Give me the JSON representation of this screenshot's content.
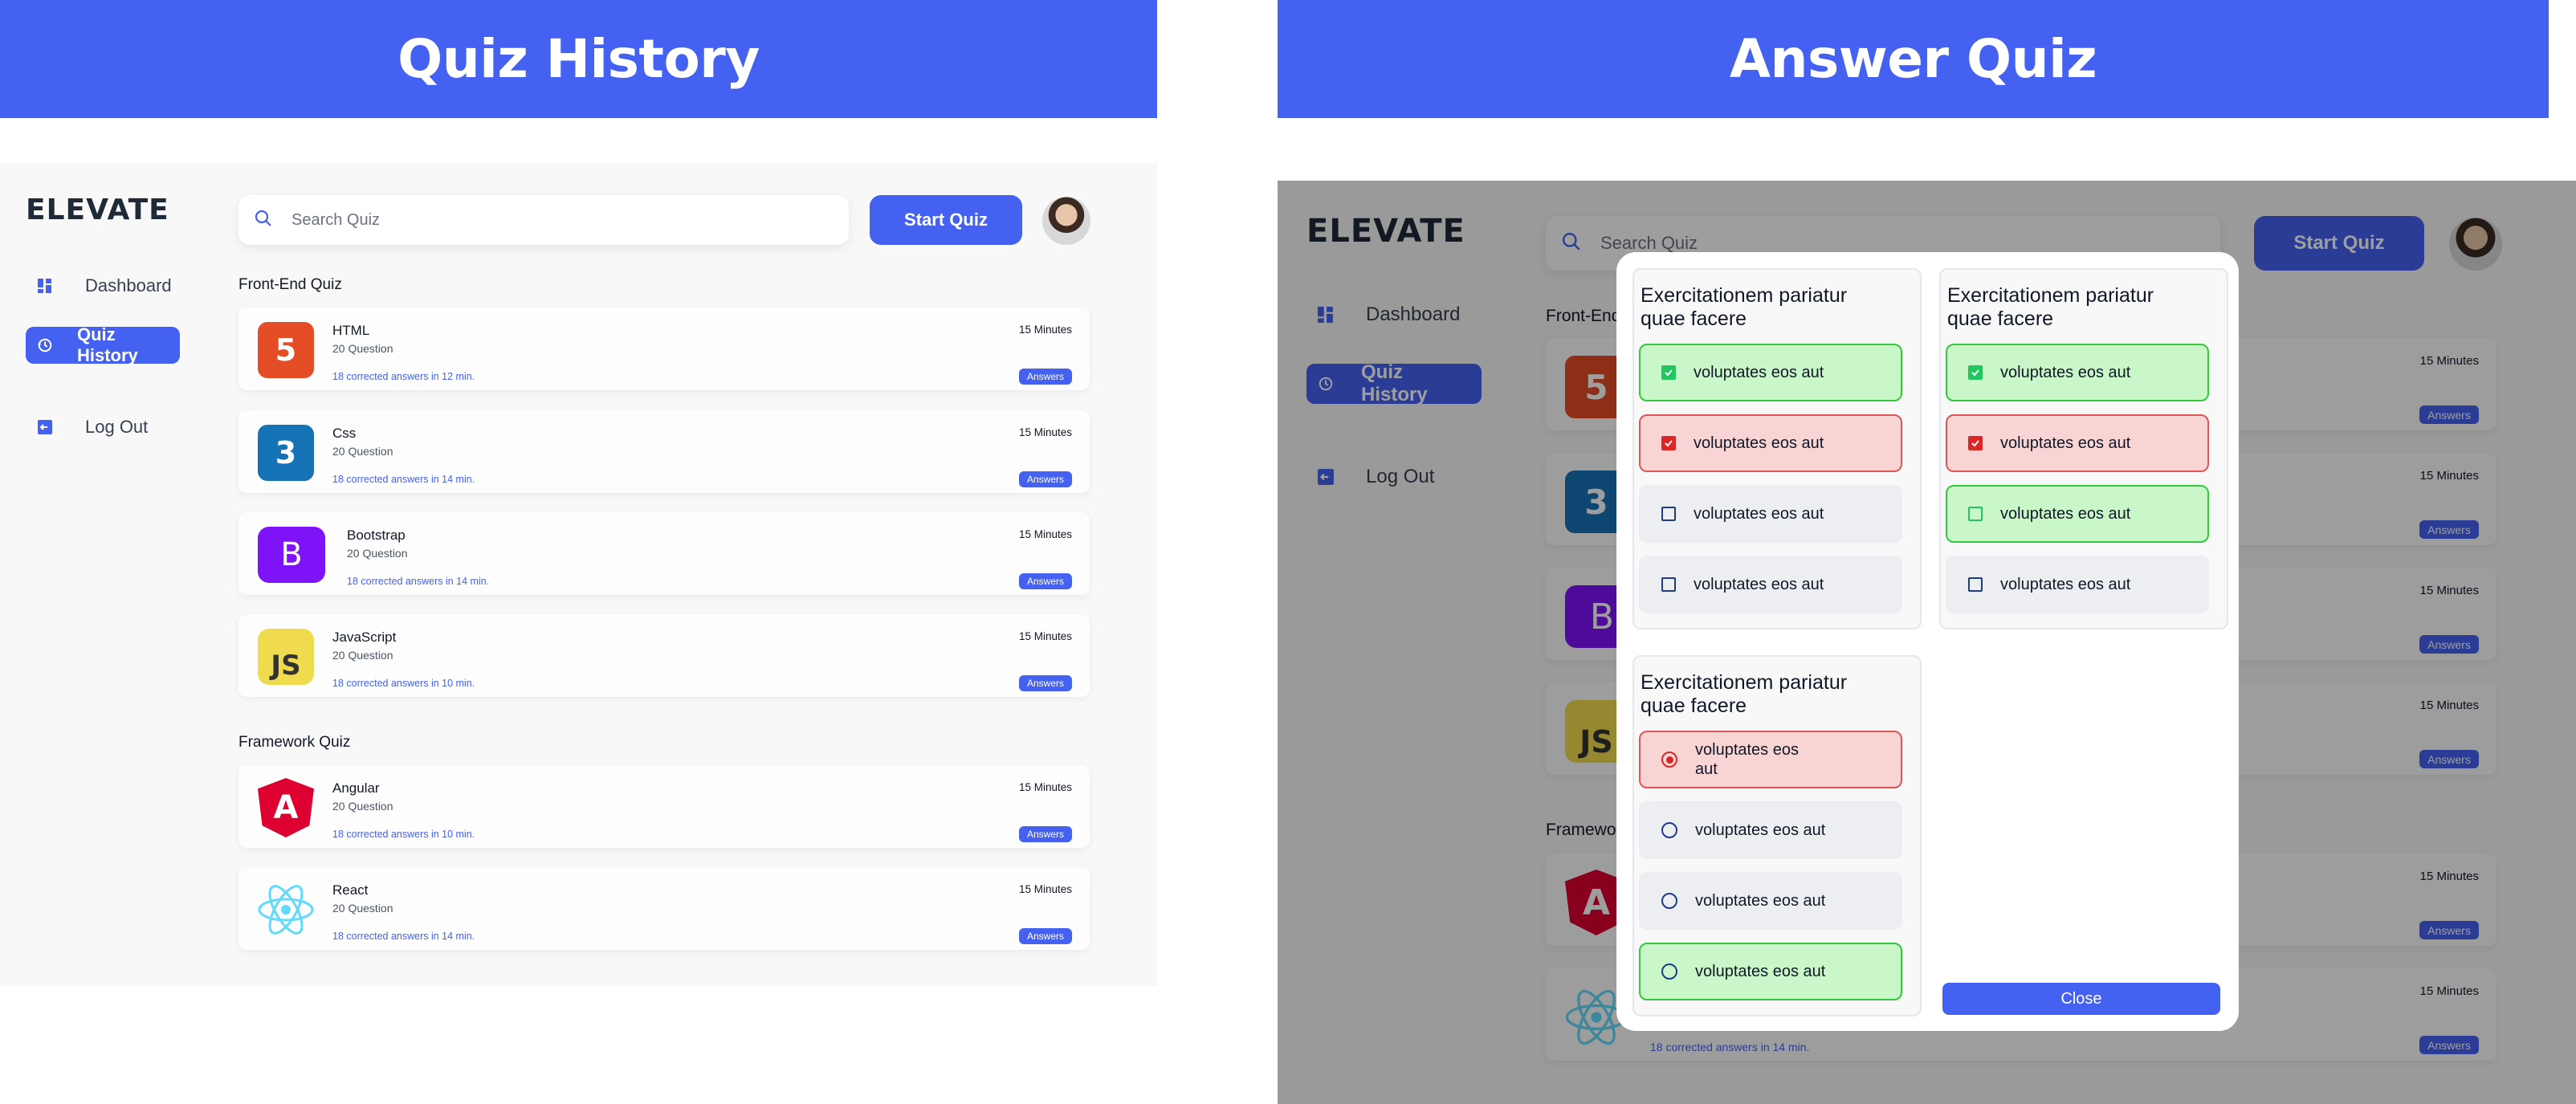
{
  "left": {
    "banner_title": "Quiz History",
    "logo": "ELEVATE",
    "nav": [
      {
        "label": "Dashboard",
        "icon": "dashboard-icon"
      },
      {
        "label": "Quiz History",
        "icon": "history-icon",
        "active": true
      },
      {
        "label": "Log Out",
        "icon": "logout-icon"
      }
    ],
    "search_placeholder": "Search Quiz",
    "start_button": "Start Quiz",
    "sections": [
      {
        "title": "Front-End Quiz",
        "items": [
          {
            "name": "HTML",
            "questions": "20 Question",
            "duration": "15 Minutes",
            "result": "18 corrected answers in 12 min.",
            "answers_label": "Answers",
            "icon": "html5-icon",
            "icon_text": "5",
            "color": "#e44d26"
          },
          {
            "name": "Css",
            "questions": "20 Question",
            "duration": "15 Minutes",
            "result": "18 corrected answers in 14 min.",
            "answers_label": "Answers",
            "icon": "css3-icon",
            "icon_text": "3",
            "color": "#1572b6"
          },
          {
            "name": "Bootstrap",
            "questions": "20 Question",
            "duration": "15 Minutes",
            "result": "18 corrected answers in 14 min.",
            "answers_label": "Answers",
            "icon": "bootstrap-icon",
            "icon_text": "B",
            "color": "#7e13f8"
          },
          {
            "name": "JavaScript",
            "questions": "20 Question",
            "duration": "15 Minutes",
            "result": "18 corrected answers in 10 min.",
            "answers_label": "Answers",
            "icon": "javascript-icon",
            "icon_text": "JS",
            "color": "#f0db4f"
          }
        ]
      },
      {
        "title": "Framework Quiz",
        "items": [
          {
            "name": "Angular",
            "questions": "20 Question",
            "duration": "15 Minutes",
            "result": "18 corrected answers in 10 min.",
            "answers_label": "Answers",
            "icon": "angular-icon",
            "icon_text": "A",
            "color": "#dd0031"
          },
          {
            "name": "React",
            "questions": "20 Question",
            "duration": "15 Minutes",
            "result": "18 corrected answers in 14 min.",
            "answers_label": "Answers",
            "icon": "react-icon",
            "icon_text": "⚛",
            "color": "#61dafb"
          }
        ]
      }
    ]
  },
  "right": {
    "banner_title": "Answer Quiz",
    "logo": "ELEVATE",
    "nav": [
      {
        "label": "Dashboard"
      },
      {
        "label": "Quiz History"
      },
      {
        "label": "Log Out"
      }
    ],
    "search_placeholder": "Search Quiz",
    "start_button": "Start Quiz",
    "bg_section_1": "Front-End",
    "bg_section_2": "Framewo",
    "bg_duration": "15 Minutes",
    "bg_answers": "Answers",
    "bg_last_result": "18 corrected answers in 14 min.",
    "modal": {
      "questions": [
        {
          "title": "Exercitationem pariatur quae facere",
          "type": "checkbox",
          "options": [
            {
              "label": "voluptates eos aut",
              "state": "correct-checked"
            },
            {
              "label": "voluptates eos aut",
              "state": "wrong-checked"
            },
            {
              "label": "voluptates eos aut",
              "state": "neutral"
            },
            {
              "label": "voluptates eos aut",
              "state": "neutral"
            }
          ]
        },
        {
          "title": "Exercitationem pariatur quae facere",
          "type": "checkbox",
          "options": [
            {
              "label": "voluptates eos aut",
              "state": "correct-checked"
            },
            {
              "label": "voluptates eos aut",
              "state": "wrong-checked"
            },
            {
              "label": "voluptates eos aut",
              "state": "correct-missed"
            },
            {
              "label": "voluptates eos aut",
              "state": "neutral"
            }
          ]
        },
        {
          "title": "Exercitationem pariatur quae facere",
          "type": "radio",
          "options": [
            {
              "label": "voluptates eos aut",
              "state": "wrong-checked"
            },
            {
              "label": "voluptates eos aut",
              "state": "neutral"
            },
            {
              "label": "voluptates eos aut",
              "state": "neutral"
            },
            {
              "label": "voluptates eos aut",
              "state": "correct-missed"
            }
          ]
        }
      ],
      "close_label": "Close"
    }
  },
  "colors": {
    "primary": "#4461f2",
    "correct": "#c9f7c9",
    "wrong": "#f8d4d4"
  }
}
